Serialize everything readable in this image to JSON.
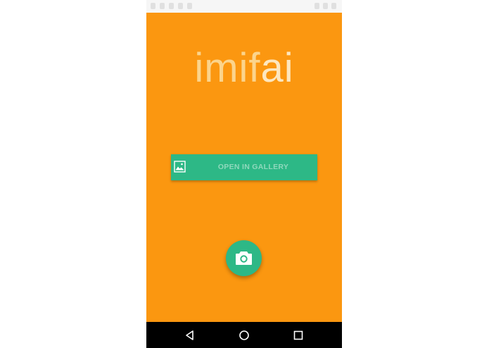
{
  "app": {
    "logo_part1": "imif",
    "logo_part2": "ai"
  },
  "buttons": {
    "gallery_label": "OPEN IN GALLERY",
    "gallery_icon": "image-icon",
    "camera_icon": "camera-icon"
  },
  "navigation": {
    "back_icon": "back-triangle-icon",
    "home_icon": "home-circle-icon",
    "recents_icon": "recents-square-icon"
  },
  "colors": {
    "background": "#fb9710",
    "accent": "#2db886",
    "nav_bar": "#000000"
  }
}
